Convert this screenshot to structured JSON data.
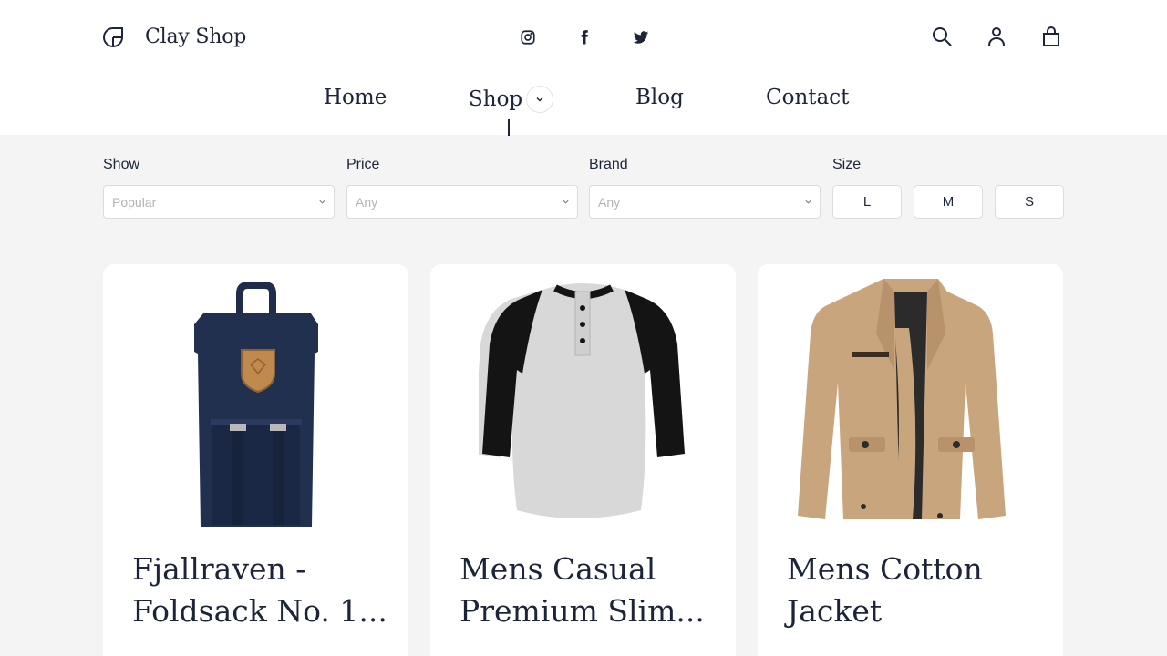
{
  "brand": {
    "name": "Clay Shop"
  },
  "social": [
    {
      "icon": "instagram-icon"
    },
    {
      "icon": "facebook-icon"
    },
    {
      "icon": "twitter-icon"
    }
  ],
  "tools": [
    {
      "icon": "search-icon"
    },
    {
      "icon": "user-icon"
    },
    {
      "icon": "shopping-bag-icon"
    }
  ],
  "nav": {
    "home": "Home",
    "shop": "Shop",
    "blog": "Blog",
    "contact": "Contact",
    "active": "Shop"
  },
  "filters": {
    "show": {
      "label": "Show",
      "value": "Popular"
    },
    "price": {
      "label": "Price",
      "value": "Any"
    },
    "brand": {
      "label": "Brand",
      "value": "Any"
    },
    "size": {
      "label": "Size",
      "options": [
        "L",
        "M",
        "S"
      ]
    }
  },
  "products": [
    {
      "title": "Fjallraven - Foldsack No. 1...",
      "image": "backpack"
    },
    {
      "title": "Mens Casual Premium Slim...",
      "image": "raglan-shirt"
    },
    {
      "title": "Mens Cotton Jacket",
      "image": "jacket"
    }
  ],
  "colors": {
    "text": "#1c2538",
    "page_bg": "#f4f4f4",
    "card_bg": "#ffffff"
  }
}
